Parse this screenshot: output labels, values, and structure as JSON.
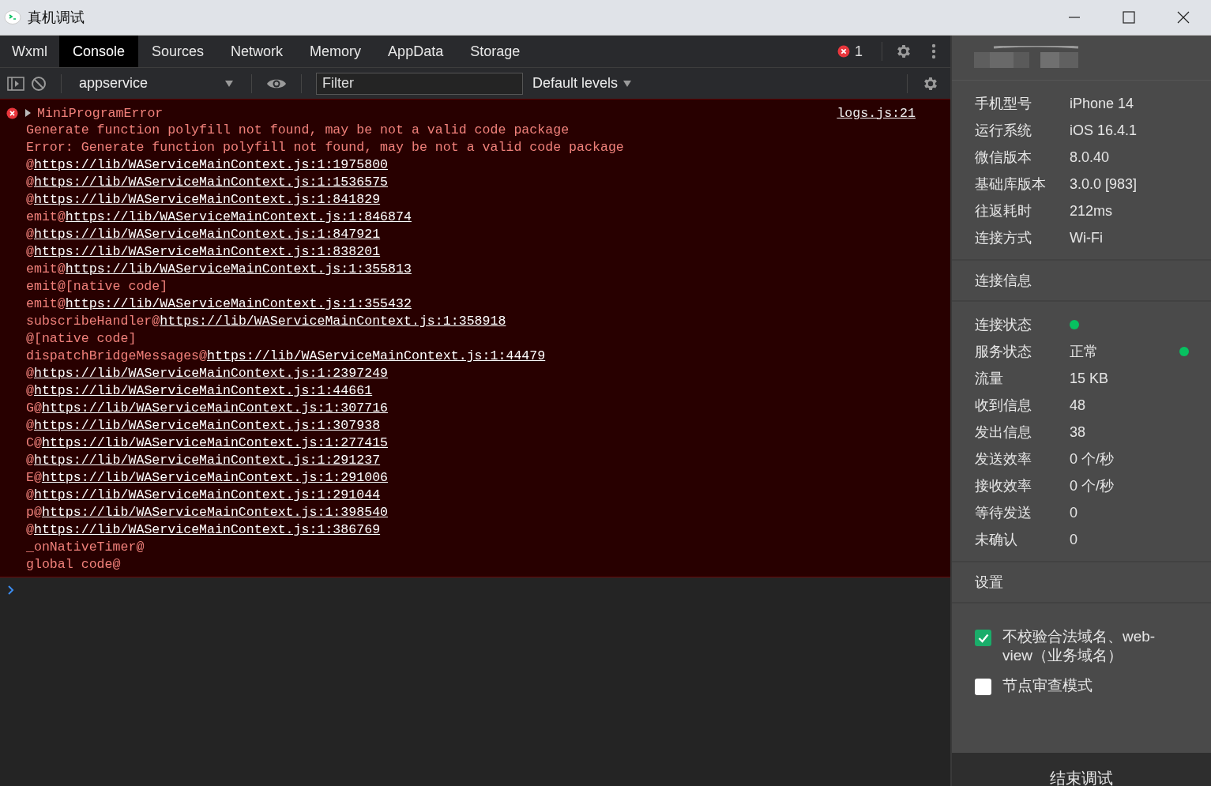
{
  "window": {
    "title": "真机调试"
  },
  "tabs": [
    {
      "label": "Wxml",
      "selected": false
    },
    {
      "label": "Console",
      "selected": true
    },
    {
      "label": "Sources",
      "selected": false
    },
    {
      "label": "Network",
      "selected": false
    },
    {
      "label": "Memory",
      "selected": false
    },
    {
      "label": "AppData",
      "selected": false
    },
    {
      "label": "Storage",
      "selected": false
    }
  ],
  "error_count": "1",
  "toolbar": {
    "context": "appservice",
    "filter_placeholder": "Filter",
    "levels": "Default levels"
  },
  "console": {
    "error": {
      "title": "MiniProgramError",
      "source": "logs.js:21",
      "lines": [
        {
          "text": "Generate function polyfill not found, may be not a valid code package"
        },
        {
          "text": "Error: Generate function polyfill not found, may be not a valid code package"
        },
        {
          "text": "@",
          "link": "https://lib/WAServiceMainContext.js:1:1975800"
        },
        {
          "text": "@",
          "link": "https://lib/WAServiceMainContext.js:1:1536575"
        },
        {
          "text": "@",
          "link": "https://lib/WAServiceMainContext.js:1:841829"
        },
        {
          "text": "emit@",
          "link": "https://lib/WAServiceMainContext.js:1:846874"
        },
        {
          "text": "@",
          "link": "https://lib/WAServiceMainContext.js:1:847921"
        },
        {
          "text": "@",
          "link": "https://lib/WAServiceMainContext.js:1:838201"
        },
        {
          "text": "emit@",
          "link": "https://lib/WAServiceMainContext.js:1:355813"
        },
        {
          "text": "emit@[native code]"
        },
        {
          "text": "emit@",
          "link": "https://lib/WAServiceMainContext.js:1:355432"
        },
        {
          "text": "subscribeHandler@",
          "link": "https://lib/WAServiceMainContext.js:1:358918"
        },
        {
          "text": "@[native code]"
        },
        {
          "text": "dispatchBridgeMessages@",
          "link": "https://lib/WAServiceMainContext.js:1:44479"
        },
        {
          "text": "@",
          "link": "https://lib/WAServiceMainContext.js:1:2397249"
        },
        {
          "text": "@",
          "link": "https://lib/WAServiceMainContext.js:1:44661"
        },
        {
          "text": "G@",
          "link": "https://lib/WAServiceMainContext.js:1:307716"
        },
        {
          "text": "@",
          "link": "https://lib/WAServiceMainContext.js:1:307938"
        },
        {
          "text": "C@",
          "link": "https://lib/WAServiceMainContext.js:1:277415"
        },
        {
          "text": "@",
          "link": "https://lib/WAServiceMainContext.js:1:291237"
        },
        {
          "text": "E@",
          "link": "https://lib/WAServiceMainContext.js:1:291006"
        },
        {
          "text": "@",
          "link": "https://lib/WAServiceMainContext.js:1:291044"
        },
        {
          "text": "p@",
          "link": "https://lib/WAServiceMainContext.js:1:398540"
        },
        {
          "text": "@",
          "link": "https://lib/WAServiceMainContext.js:1:386769"
        },
        {
          "text": "_onNativeTimer@"
        },
        {
          "text": "global code@"
        }
      ]
    }
  },
  "device_info": [
    {
      "label": "手机型号",
      "value": "iPhone 14"
    },
    {
      "label": "运行系统",
      "value": "iOS 16.4.1"
    },
    {
      "label": "微信版本",
      "value": "8.0.40"
    },
    {
      "label": "基础库版本",
      "value": "3.0.0 [983]"
    },
    {
      "label": "往返耗时",
      "value": "212ms"
    },
    {
      "label": "连接方式",
      "value": "Wi-Fi"
    }
  ],
  "connection": {
    "title": "连接信息",
    "rows": [
      {
        "label": "连接状态",
        "kind": "dot",
        "color": "#07c160"
      },
      {
        "label": "服务状态",
        "kind": "text-dot",
        "value": "正常",
        "color": "#07c160"
      },
      {
        "label": "流量",
        "kind": "text",
        "value": "15 KB"
      },
      {
        "label": "收到信息",
        "kind": "text",
        "value": "48"
      },
      {
        "label": "发出信息",
        "kind": "text",
        "value": "38"
      },
      {
        "label": "发送效率",
        "kind": "text",
        "value": "0 个/秒"
      },
      {
        "label": "接收效率",
        "kind": "text",
        "value": "0 个/秒"
      },
      {
        "label": "等待发送",
        "kind": "text",
        "value": "0"
      },
      {
        "label": "未确认",
        "kind": "text",
        "value": "0"
      }
    ]
  },
  "settings": {
    "title": "设置",
    "options": [
      {
        "label": "不校验合法域名、web-view（业务域名）",
        "checked": true
      },
      {
        "label": "节点审查模式",
        "checked": false
      }
    ]
  },
  "end_button": "结束调试"
}
